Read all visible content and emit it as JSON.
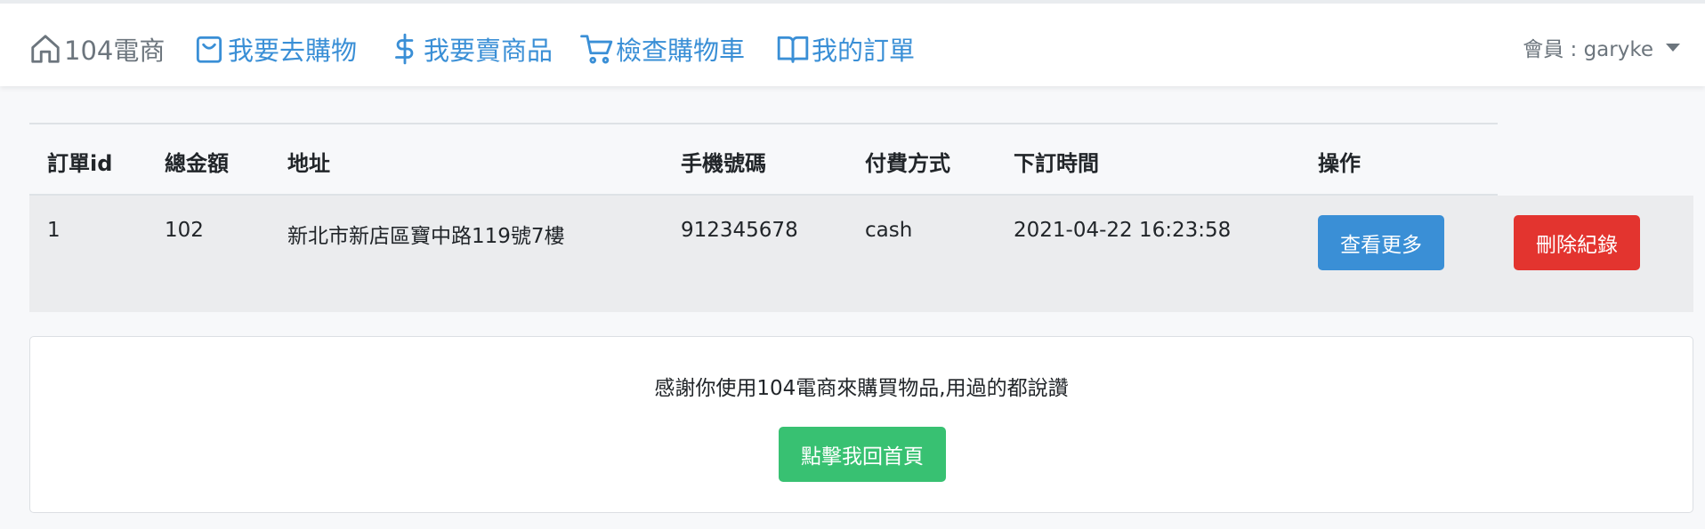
{
  "nav": {
    "brand": "104電商",
    "items": [
      {
        "label": "我要去購物",
        "icon": "shopping-bag-icon"
      },
      {
        "label": "我要賣商品",
        "icon": "dollar-icon"
      },
      {
        "label": "檢查購物車",
        "icon": "cart-icon"
      },
      {
        "label": "我的訂單",
        "icon": "book-icon"
      }
    ],
    "user": "會員 : garyke"
  },
  "orders": {
    "headers": [
      "訂單id",
      "總金額",
      "地址",
      "手機號碼",
      "付費方式",
      "下訂時間",
      "操作"
    ],
    "rows": [
      {
        "id": "1",
        "total": "102",
        "address": "新北市新店區寶中路119號7樓",
        "phone": "912345678",
        "payment": "cash",
        "time": "2021-04-22 16:23:58",
        "more_label": "查看更多",
        "delete_label": "刪除紀錄"
      }
    ]
  },
  "thanks": {
    "message": "感謝你使用104電商來購買物品,用過的都說讚",
    "home_button": "點擊我回首頁"
  },
  "colors": {
    "link": "#3a8fd6",
    "primary": "#3a8fd6",
    "danger": "#e3342f",
    "success": "#38c172"
  }
}
